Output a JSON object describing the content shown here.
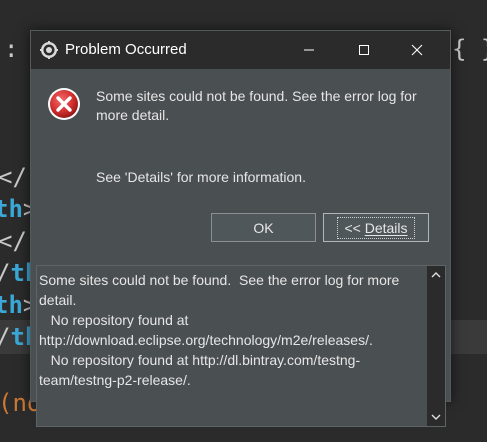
{
  "dialog": {
    "title": "Problem Occurred",
    "message": "Some sites could not be found.  See the error log for more detail.",
    "hint": "See 'Details' for more information.",
    "ok_label": "OK",
    "details_prefix": "<< ",
    "details_label": "Details",
    "details_text": "Some sites could not be found.  See the error log for more detail.\n   No repository found at http://download.eclipse.org/technology/m2e/releases/.\n   No repository found at http://dl.bintray.com/testng-team/testng-p2-release/."
  },
  "icons": {
    "app": "eclipse-gear-icon",
    "error": "error-icon",
    "minimize": "minimize-icon",
    "maximize": "maximize-icon",
    "close": "close-icon",
    "scroll_up": "chevron-up-icon",
    "scroll_down": "chevron-down-icon"
  },
  "colors": {
    "dialog_bg": "#4a4f51",
    "titlebar_bg": "#2b2b2b",
    "error_red": "#d32f2f",
    "editor_bg": "#2b2b2b",
    "tag_blue": "#3aa8d8",
    "keyword_orange": "#cc7832"
  }
}
